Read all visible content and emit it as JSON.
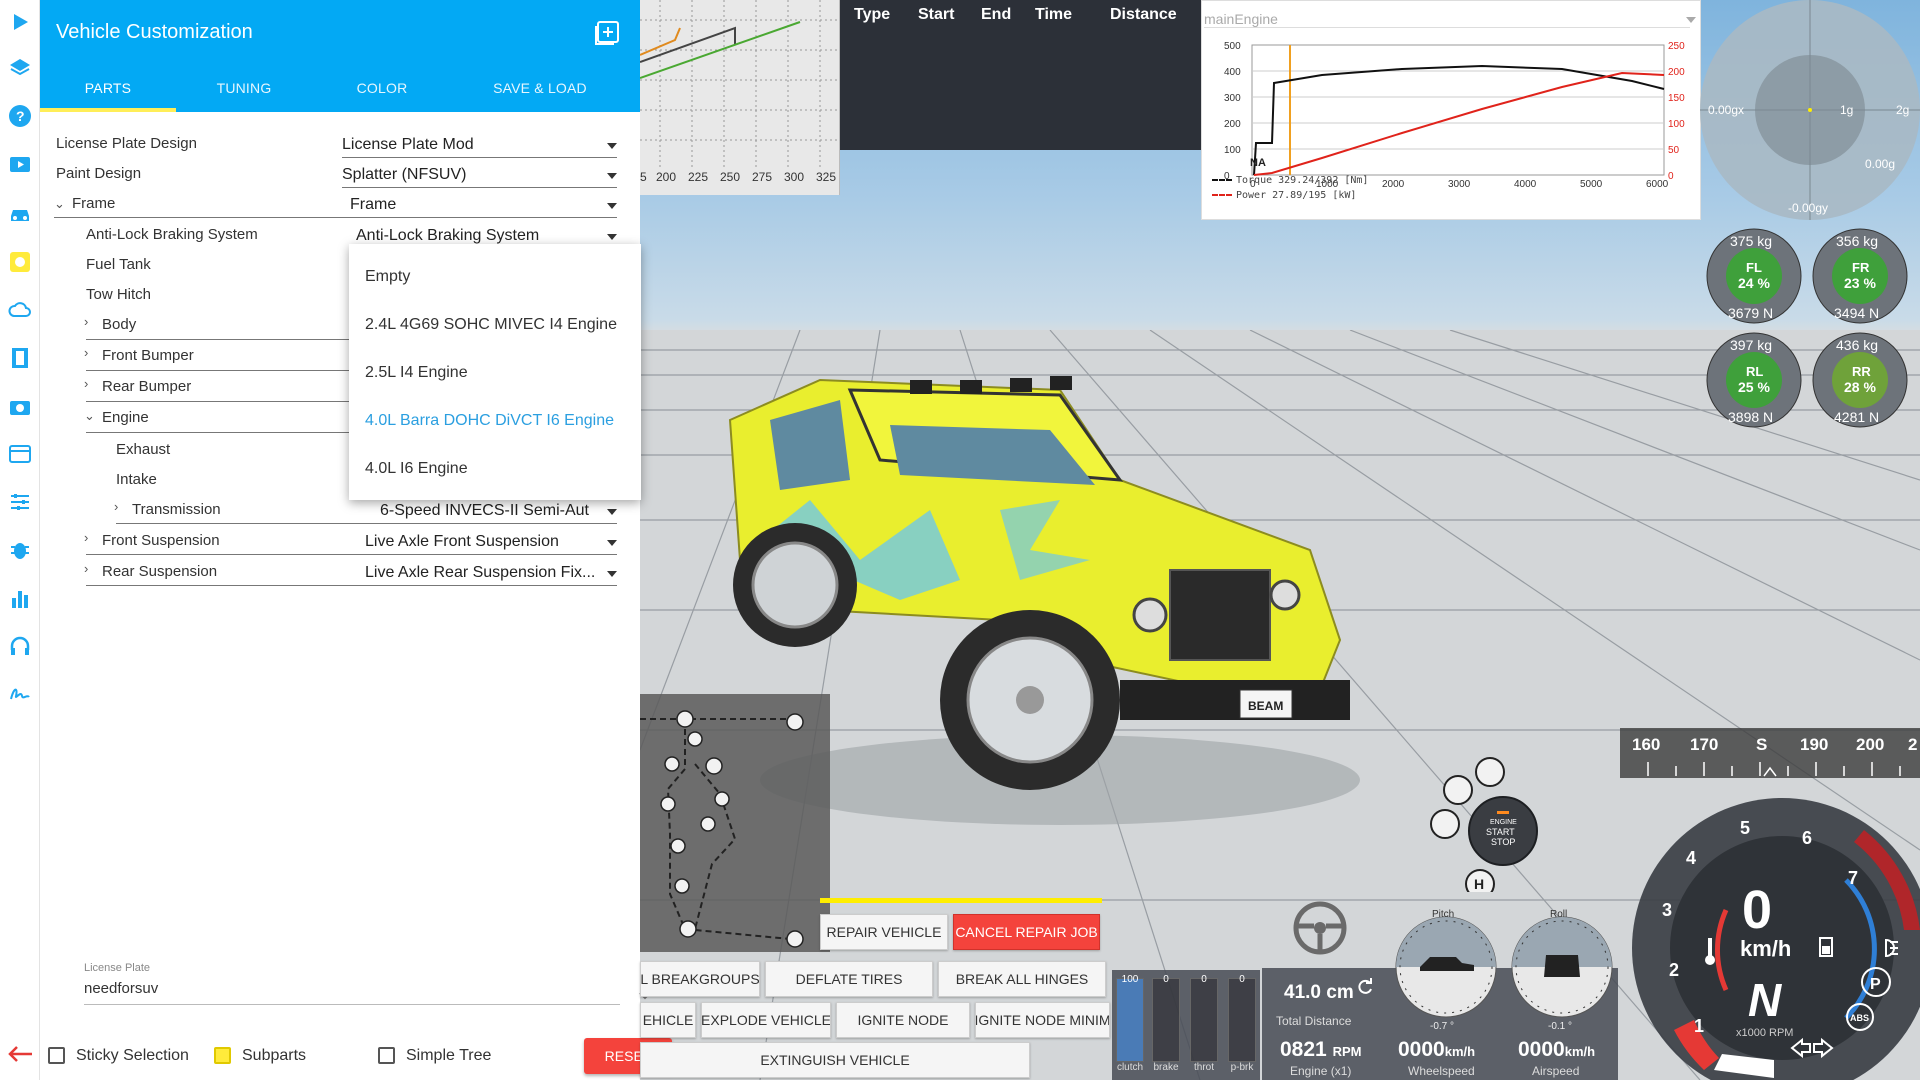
{
  "panel": {
    "title": "Vehicle Customization",
    "tabs": [
      "PARTS",
      "TUNING",
      "COLOR",
      "SAVE & LOAD"
    ],
    "rows": [
      {
        "label": "License Plate Design",
        "value": "License Plate Mod"
      },
      {
        "label": "Paint Design",
        "value": "Splatter (NFSUV)"
      },
      {
        "label": "Frame",
        "value": "Frame"
      },
      {
        "label": "Anti-Lock Braking System",
        "value": "Anti-Lock Braking System"
      },
      {
        "label": "Fuel Tank",
        "value": ""
      },
      {
        "label": "Tow Hitch",
        "value": ""
      },
      {
        "label": "Body",
        "value": ""
      },
      {
        "label": "Front Bumper",
        "value": ""
      },
      {
        "label": "Rear Bumper",
        "value": ""
      },
      {
        "label": "Engine",
        "value": ""
      },
      {
        "label": "Exhaust",
        "value": ""
      },
      {
        "label": "Intake",
        "value": ""
      },
      {
        "label": "Transmission",
        "value": "6-Speed INVECS-II Semi-Aut..."
      },
      {
        "label": "Front Suspension",
        "value": "Live Axle Front Suspension"
      },
      {
        "label": "Rear Suspension",
        "value": "Live Axle Rear Suspension Fix..."
      }
    ],
    "dropdown": [
      "Empty",
      "2.4L 4G69 SOHC MIVEC I4 Engine",
      "2.5L I4 Engine",
      "4.0L Barra DOHC DiVCT I6 Engine",
      "4.0L I6 Engine"
    ],
    "license_plate_label": "License Plate",
    "license_plate_value": "needforsuv",
    "sticky_selection": "Sticky Selection",
    "subparts": "Subparts",
    "simple_tree": "Simple Tree",
    "reset": "RESET"
  },
  "grid_graph": {
    "ticks": [
      "5",
      "200",
      "225",
      "250",
      "275",
      "300",
      "325"
    ]
  },
  "timer_table": {
    "headers": [
      "Type",
      "Start",
      "End",
      "Time",
      "Distance"
    ]
  },
  "engine_chart": {
    "select": "mainEngine",
    "left_ticks": [
      "500",
      "400",
      "300",
      "200",
      "100",
      "0"
    ],
    "right_ticks": [
      "250",
      "200",
      "150",
      "100",
      "50",
      "0"
    ],
    "x_ticks": [
      "0",
      "1000",
      "2000",
      "3000",
      "4000",
      "5000",
      "6000"
    ],
    "legend_title": "NA",
    "legend_torque": "Torque 329.24/392 [Nm]",
    "legend_power": "Power  27.89/195  [kW]",
    "colors": {
      "torque": "#111111",
      "power": "#e0231b",
      "marker": "#f0a020"
    }
  },
  "gmeter": {
    "gx": "0.00gx",
    "g1": "1g",
    "g2": "2g",
    "g_total": "0.00g",
    "gy": "-0.00gy"
  },
  "tires": [
    {
      "id": "FL",
      "kg": "375 kg",
      "pct": "24 %",
      "n": "3679 N"
    },
    {
      "id": "FR",
      "kg": "356 kg",
      "pct": "23 %",
      "n": "3494 N"
    },
    {
      "id": "RL",
      "kg": "397 kg",
      "pct": "25 %",
      "n": "3898 N"
    },
    {
      "id": "RR",
      "kg": "436 kg",
      "pct": "28 %",
      "n": "4281 N"
    }
  ],
  "engine_button": {
    "l1": "ENGINE",
    "l2": "START",
    "l3": "STOP"
  },
  "buttons": {
    "repair": "REPAIR VEHICLE",
    "cancel_repair": "CANCEL REPAIR JOB",
    "breakgroups": "L BREAKGROUPS",
    "deflate": "DEFLATE TIRES",
    "break_hinges": "BREAK ALL HINGES",
    "vehicle": "EHICLE",
    "explode": "EXPLODE VEHICLE",
    "ignite": "IGNITE NODE",
    "ignite_min": "IGNITE NODE MINIM",
    "extinguish": "EXTINGUISH VEHICLE"
  },
  "pedals": [
    {
      "label": "clutch",
      "value": "100"
    },
    {
      "label": "brake",
      "value": "0"
    },
    {
      "label": "throt",
      "value": "0"
    },
    {
      "label": "p-brk",
      "value": "0"
    }
  ],
  "stats": {
    "distance": "41.0 cm",
    "distance_label": "Total Distance",
    "rpm": "0821",
    "rpm_unit": "RPM",
    "rpm_label": "Engine (x1)",
    "wheelspeed": "0000",
    "wheelspeed_unit": "km/h",
    "wheelspeed_label": "Wheelspeed",
    "airspeed": "0000",
    "airspeed_unit": "km/h",
    "airspeed_label": "Airspeed",
    "pitch_label": "Pitch",
    "roll_label": "Roll",
    "pitch_value": "-0.7 °",
    "roll_value": "-0.1 °"
  },
  "compass": [
    "160",
    "170",
    "S",
    "190",
    "200",
    "2"
  ],
  "speedo": {
    "speed": "0",
    "unit": "km/h",
    "gear": "N",
    "rpm_label": "x1000 RPM",
    "numbers": [
      "1",
      "2",
      "3",
      "4",
      "5",
      "6",
      "7"
    ],
    "abs": "ABS",
    "park": "P"
  }
}
